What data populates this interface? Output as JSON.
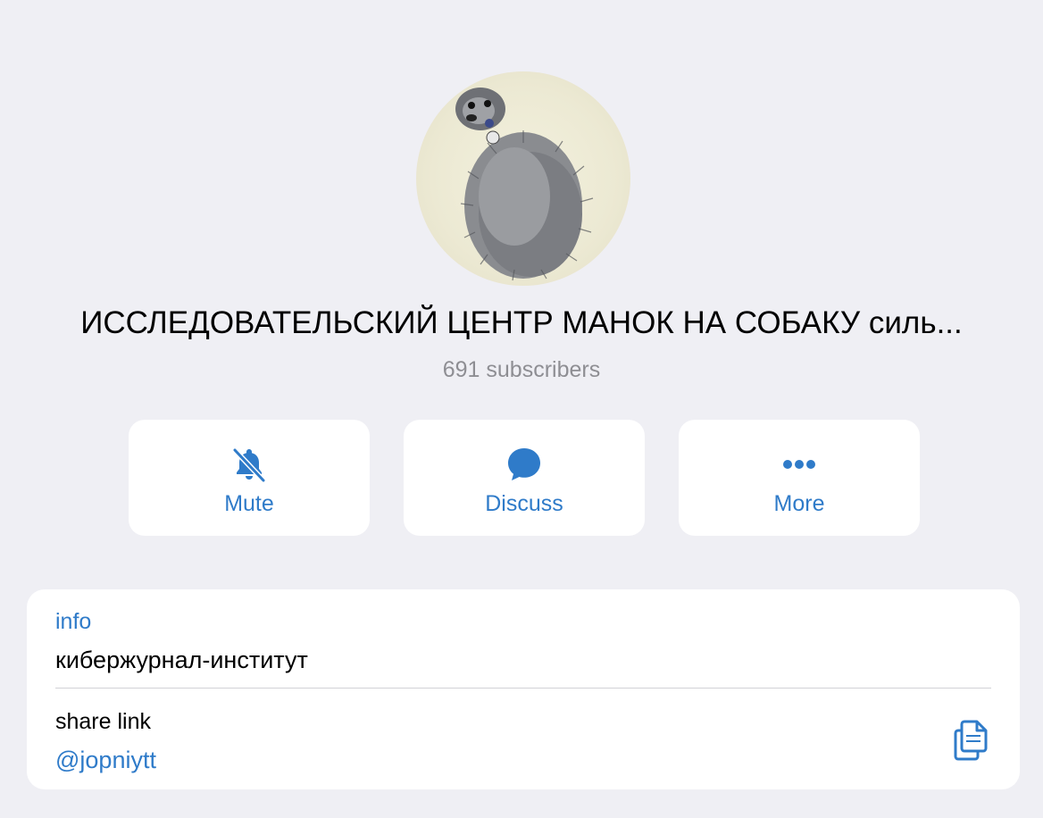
{
  "channel": {
    "title": "ИССЛЕДОВАТЕЛЬСКИЙ ЦЕНТР МАНОК НА СОБАКУ силь...",
    "subscribers": "691 subscribers",
    "avatar_icon": "hedgehog-avatar"
  },
  "actions": [
    {
      "label": "Mute",
      "icon": "bell-slash-icon"
    },
    {
      "label": "Discuss",
      "icon": "chat-bubble-icon"
    },
    {
      "label": "More",
      "icon": "ellipsis-icon"
    }
  ],
  "info": {
    "label": "info",
    "value": "кибержурнал-институт"
  },
  "share": {
    "label": "share link",
    "value": "@jopniytt",
    "icon": "copy-icon"
  },
  "colors": {
    "background": "#efeff4",
    "card": "#ffffff",
    "accent": "#2f7bc9",
    "secondary_text": "#8e8e93"
  }
}
